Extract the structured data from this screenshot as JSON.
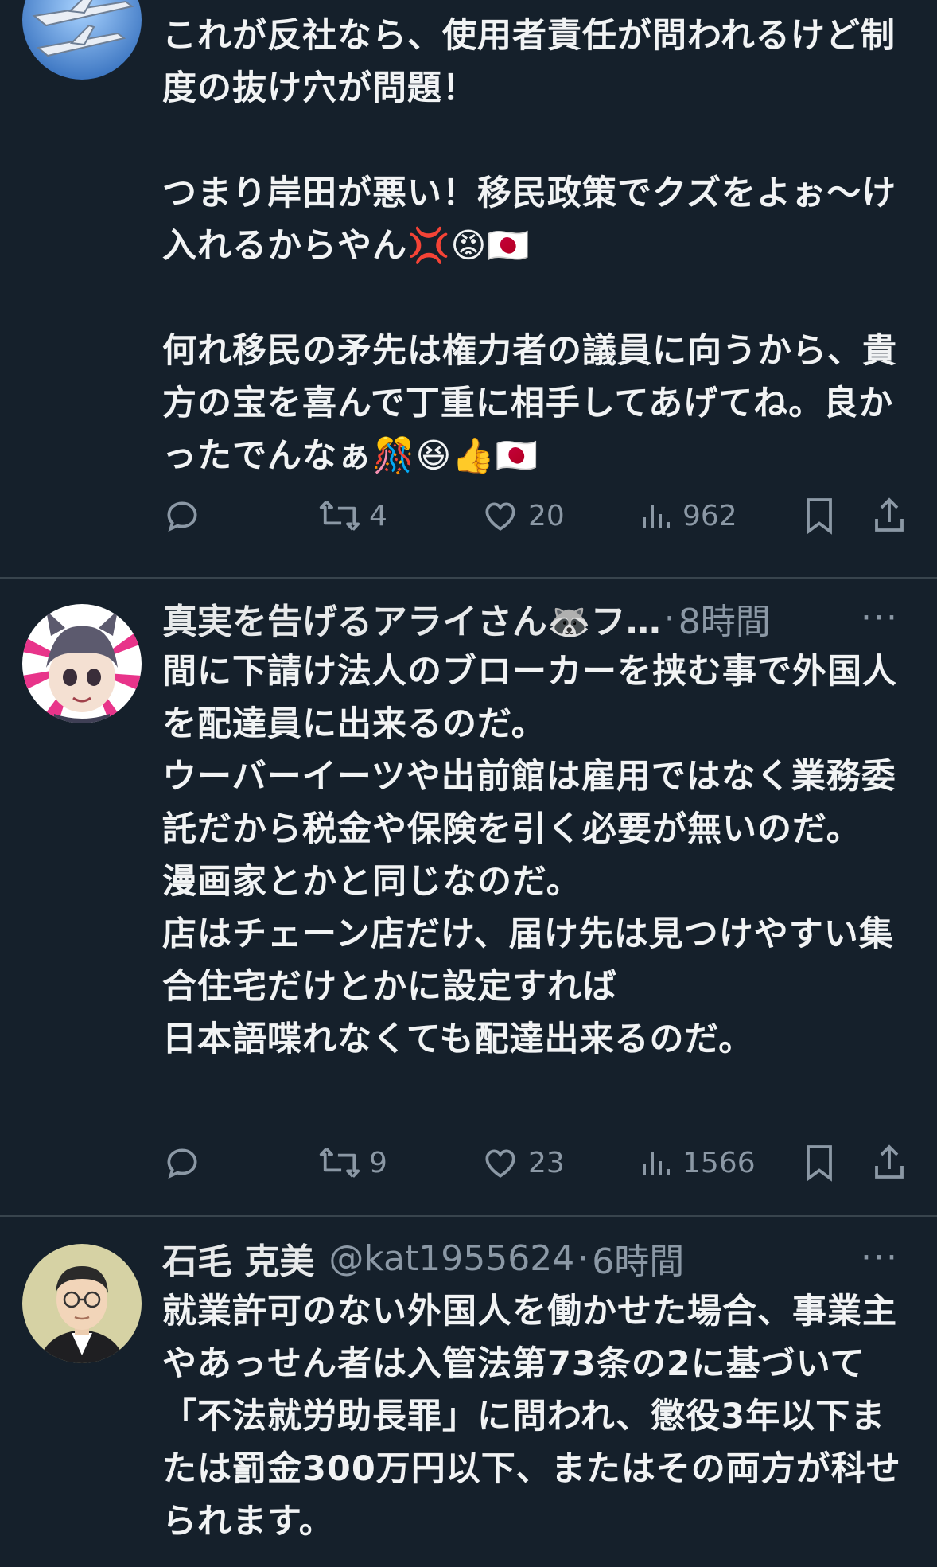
{
  "colors": {
    "background": "#15202b",
    "text": "#e7e9ea",
    "secondary": "#8b98a5",
    "divider": "#38444d"
  },
  "tweets": [
    {
      "avatar": "military-jets-avatar",
      "text": "これが反社なら、使用者責任が問われるけど制度の抜け穴が問題！\n\nつまり岸田が悪い！移民政策でクズをよぉ〜け入れるからやん💢😡🇯🇵\n\n何れ移民の矛先は権力者の議員に向うから、貴方の宝を喜んで丁重に相手してあげてね。良かったでんなぁ🎊😆👍🇯🇵",
      "actions": {
        "retweets": "4",
        "likes": "20",
        "views": "962"
      }
    },
    {
      "avatar": "anime-raccoon-girl-avatar",
      "name": "真実を告げるアライさん🦝フ…",
      "dot": "·",
      "time": "8時間",
      "more": "···",
      "text": "間に下請け法人のブローカーを挟む事で外国人を配達員に出来るのだ。\nウーバーイーツや出前館は雇用ではなく業務委託だから税金や保険を引く必要が無いのだ。\n漫画家とかと同じなのだ。\n店はチェーン店だけ、届け先は見つけやすい集合住宅だけとかに設定すれば\n日本語喋れなくても配達出来るのだ。",
      "actions": {
        "retweets": "9",
        "likes": "23",
        "views": "1566"
      }
    },
    {
      "avatar": "man-glasses-avatar",
      "name": "石毛 克美",
      "handle": "@kat1955624",
      "dot": "·",
      "time": "6時間",
      "more": "···",
      "text": "就業許可のない外国人を働かせた場合、事業主やあっせん者は入管法第73条の2に基づいて「不法就労助長罪」に問われ、懲役3年以下または罰金300万円以下、またはその両方が科せられます。"
    }
  ]
}
